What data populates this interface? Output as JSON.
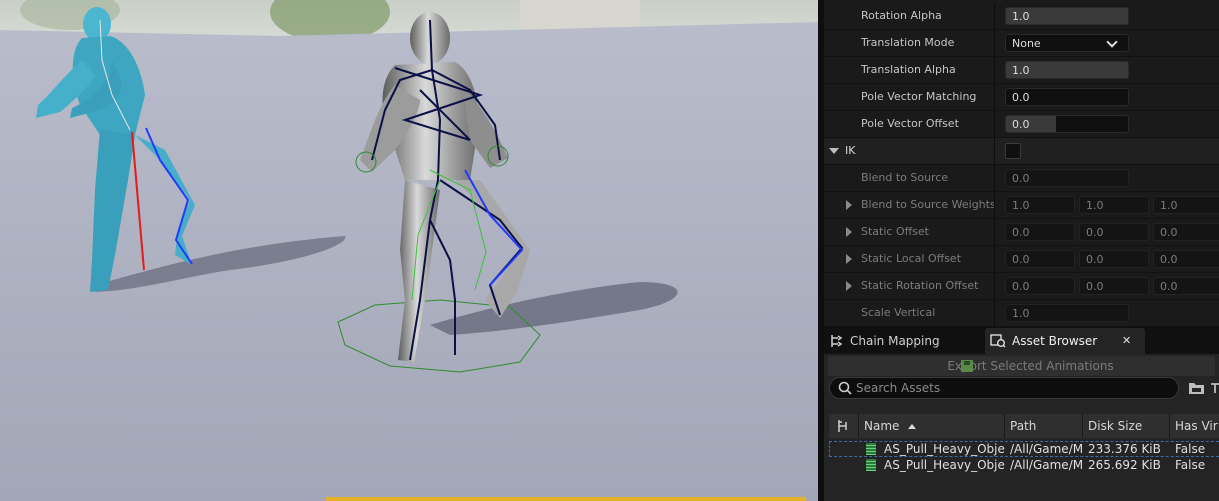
{
  "colors": {
    "panel_bg": "#1a1a1a",
    "field_bg": "#0f0f0f",
    "viewport_floor": "#a9adbc",
    "bone_blue": "#1f3cff",
    "bone_red": "#e51b1b",
    "ik_green": "#3fbf3f",
    "source_mannequin": "#4ab6d0",
    "highlight_yellow": "#e8b12c"
  },
  "viewport": {
    "source_character": "blue mannequin",
    "target_character": "silver mannequin"
  },
  "details": {
    "rows": [
      {
        "name": "Rotation Alpha",
        "value": "1.0",
        "style": "slider"
      },
      {
        "name": "Translation Mode",
        "value": "None",
        "style": "dropdown"
      },
      {
        "name": "Translation Alpha",
        "value": "1.0",
        "style": "slider"
      },
      {
        "name": "Pole Vector Matching",
        "value": "0.0",
        "style": "field"
      },
      {
        "name": "Pole Vector Offset",
        "value": "0.0",
        "style": "partial"
      }
    ],
    "ik_category": "IK",
    "ik_checked": false,
    "ik_rows": [
      {
        "name": "Blend to Source",
        "values": [
          "0.0"
        ]
      },
      {
        "name": "Blend to Source Weights",
        "values": [
          "1.0",
          "1.0",
          "1.0"
        ]
      },
      {
        "name": "Static Offset",
        "values": [
          "0.0",
          "0.0",
          "0.0"
        ]
      },
      {
        "name": "Static Local Offset",
        "values": [
          "0.0",
          "0.0",
          "0.0"
        ]
      },
      {
        "name": "Static Rotation Offset",
        "values": [
          "0.0",
          "0.0",
          "0.0"
        ]
      },
      {
        "name": "Scale Vertical",
        "values": [
          "1.0"
        ]
      }
    ]
  },
  "tabs": [
    {
      "label": "Chain Mapping",
      "icon": "chain-mapping-icon",
      "active": false
    },
    {
      "label": "Asset Browser",
      "icon": "asset-browser-icon",
      "active": true,
      "close": "✕"
    }
  ],
  "asset_browser": {
    "export_label": "Export Selected Animations",
    "search_placeholder": "Search Assets",
    "columns": [
      "Name",
      "Path",
      "Disk Size",
      "Has Vir"
    ],
    "rows": [
      {
        "name": "AS_Pull_Heavy_Objec",
        "path": "/All/Game/M",
        "size": "233.376 KiB",
        "virtual": "False"
      },
      {
        "name": "AS_Pull_Heavy_Objec",
        "path": "/All/Game/M",
        "size": "265.692 KiB",
        "virtual": "False"
      }
    ]
  }
}
